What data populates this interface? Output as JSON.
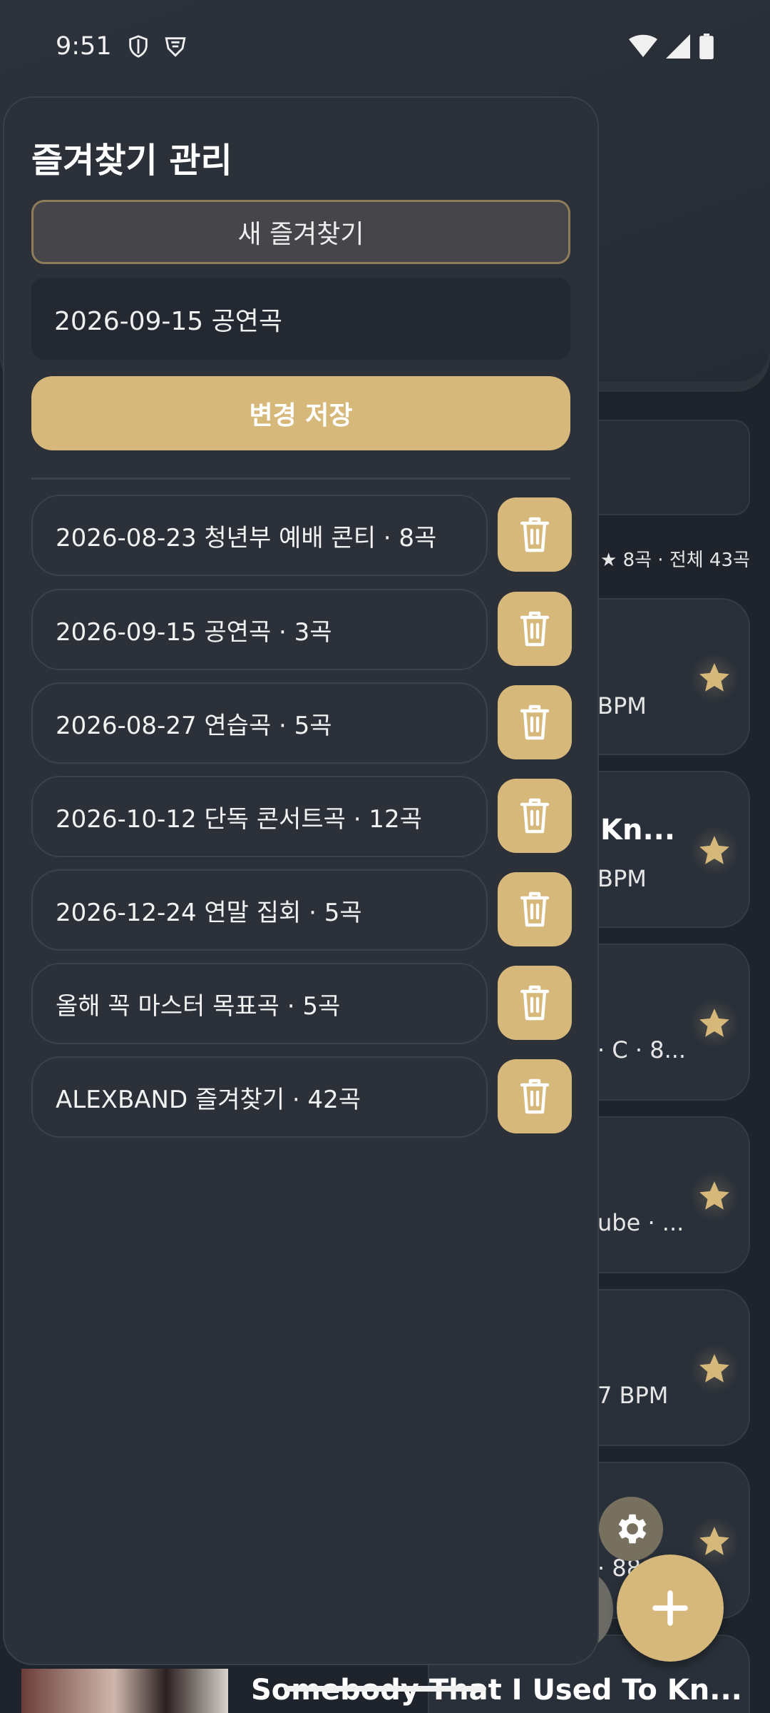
{
  "status": {
    "time": "9:51"
  },
  "drawer": {
    "title": "즐겨찾기 관리",
    "new_button_label": "새 즐겨찾기",
    "name_input_value": "2026-09-15 공연곡",
    "save_label": "변경 저장",
    "favorites": [
      {
        "label": "2026-08-23 청년부 예배 콘티 · 8곡"
      },
      {
        "label": "2026-09-15 공연곡 · 3곡"
      },
      {
        "label": "2026-08-27 연습곡 · 5곡"
      },
      {
        "label": "2026-10-12 단독 콘서트곡 · 12곡"
      },
      {
        "label": "2026-12-24 연말 집회 · 5곡"
      },
      {
        "label": "올해 꼭 마스터 목표곡 · 5곡"
      },
      {
        "label": "ALEXBAND 즐겨찾기 · 42곡"
      }
    ]
  },
  "background": {
    "count_text": "★ 8곡 · 전체 43곡",
    "cards": [
      {
        "title": "",
        "subtitle": "BPM"
      },
      {
        "title": "Kn...",
        "subtitle": "BPM"
      },
      {
        "title": "",
        "subtitle": "· C · 8..."
      },
      {
        "title": "",
        "subtitle": "ube · ..."
      },
      {
        "title": "",
        "subtitle": "7 BPM"
      },
      {
        "title": "",
        "subtitle": "· 88"
      }
    ],
    "bottom_song_title": "Somebody That I Used To Kn..."
  },
  "icons": {
    "delete": "trash-icon",
    "favorite": "star-icon",
    "settings": "gear-icon",
    "add": "plus-icon"
  },
  "colors": {
    "accent": "#d6b87b",
    "drawer_bg": "#2b3039",
    "app_bg": "#1f242c"
  }
}
